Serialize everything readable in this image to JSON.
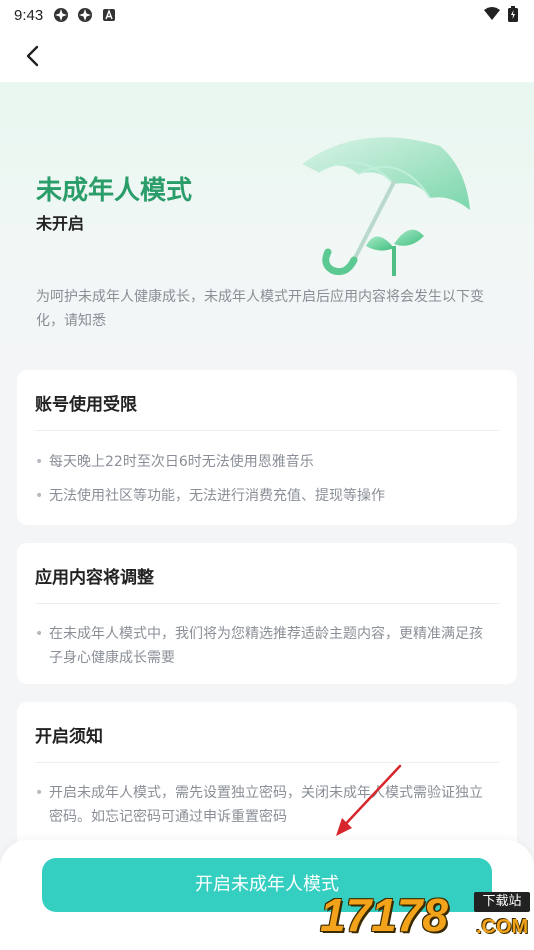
{
  "status_bar": {
    "time": "9:43",
    "icons": [
      "app-notification-icon",
      "app-notification-icon",
      "a-icon"
    ],
    "right_icons": [
      "wifi-icon",
      "battery-icon"
    ]
  },
  "nav": {
    "back_icon": "chevron-left-icon"
  },
  "hero": {
    "title": "未成年人模式",
    "status": "未开启",
    "description": "为呵护未成年人健康成长，未成年人模式开启后应用内容将会发生以下变化，请知悉",
    "title_color": "#2a9d6a",
    "illustration": "umbrella-sprout-icon"
  },
  "cards": [
    {
      "title": "账号使用受限",
      "items": [
        "每天晚上22时至次日6时无法使用恩雅音乐",
        "无法使用社区等功能，无法进行消费充值、提现等操作"
      ]
    },
    {
      "title": "应用内容将调整",
      "items": [
        "在未成年人模式中，我们将为您精选推荐适龄主题内容，更精准满足孩子身心健康成长需要"
      ]
    },
    {
      "title": "开启须知",
      "items": [
        "开启未成年人模式，需先设置独立密码，关闭未成年人模式需验证独立密码。如忘记密码可通过申诉重置密码"
      ]
    }
  ],
  "primary_button": {
    "label": "开启未成年人模式",
    "color": "#35cfc1"
  },
  "watermark": {
    "text": "17178",
    "badge": "下载站",
    "suffix": ".COM"
  }
}
